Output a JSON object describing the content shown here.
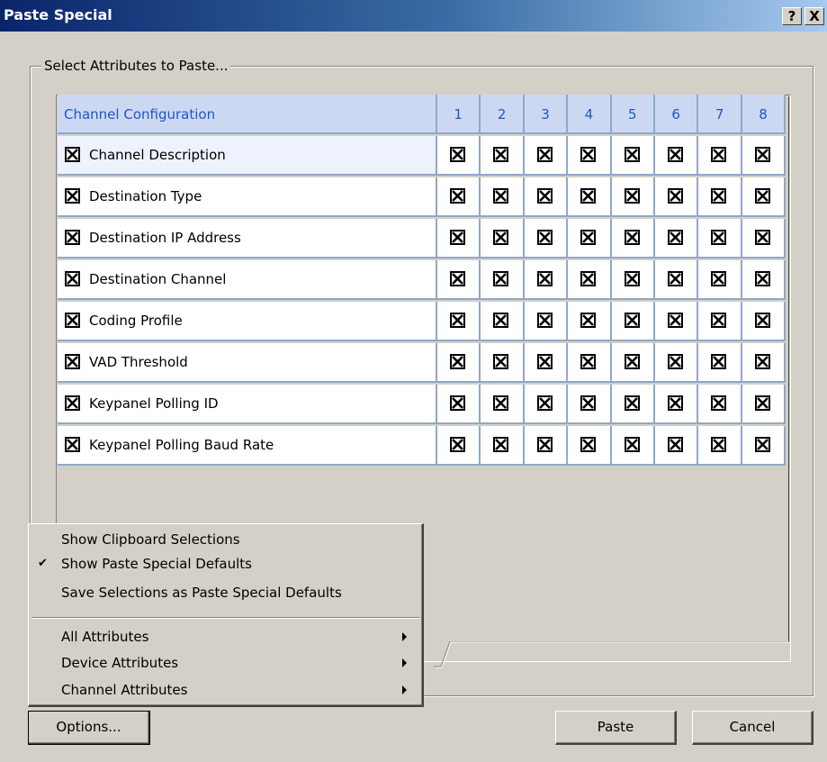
{
  "window": {
    "title": "Paste Special",
    "help_button": "?",
    "close_button": "X"
  },
  "group": {
    "legend": "Select Attributes to Paste..."
  },
  "grid": {
    "header_label": "Channel Configuration",
    "columns": [
      "1",
      "2",
      "3",
      "4",
      "5",
      "6",
      "7",
      "8"
    ],
    "rows": [
      {
        "label": "Channel Description",
        "checked": true
      },
      {
        "label": "Destination Type",
        "checked": true
      },
      {
        "label": "Destination IP Address",
        "checked": true
      },
      {
        "label": "Destination Channel",
        "checked": true
      },
      {
        "label": "Coding Profile",
        "checked": true
      },
      {
        "label": "VAD Threshold",
        "checked": true
      },
      {
        "label": "Keypanel Polling ID",
        "checked": true
      },
      {
        "label": "Keypanel Polling Baud Rate",
        "checked": true
      }
    ]
  },
  "menu": {
    "items": [
      {
        "label": "Show Clipboard Selections",
        "checked": false,
        "submenu": false
      },
      {
        "label": "Show Paste Special Defaults",
        "checked": true,
        "submenu": false
      },
      {
        "label": "Save Selections as Paste Special Defaults",
        "checked": false,
        "submenu": false
      },
      {
        "label": "All Attributes",
        "checked": false,
        "submenu": true
      },
      {
        "label": "Device Attributes",
        "checked": false,
        "submenu": true
      },
      {
        "label": "Channel Attributes",
        "checked": false,
        "submenu": true
      }
    ],
    "check_glyph": "✔"
  },
  "buttons": {
    "options": "Options...",
    "paste": "Paste",
    "cancel": "Cancel"
  }
}
